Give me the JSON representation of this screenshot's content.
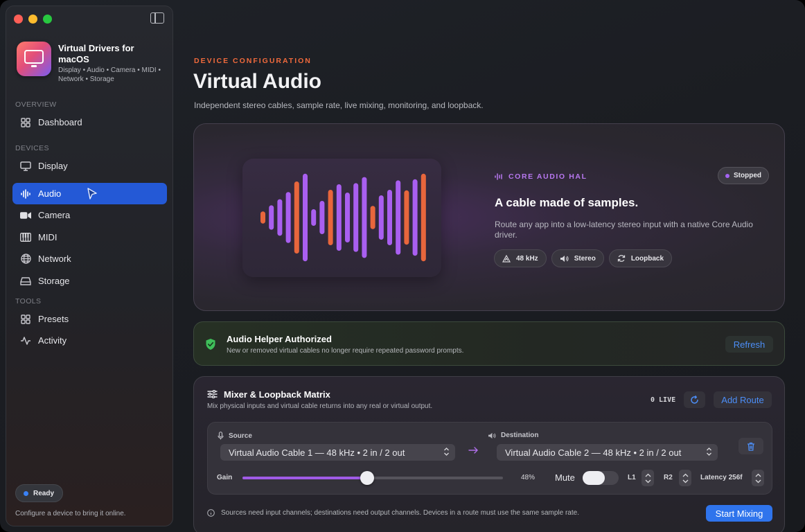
{
  "sidebar": {
    "app_title": "Virtual Drivers for macOS",
    "app_subtitle": "Display • Audio • Camera • MIDI • Network • Storage",
    "sections": {
      "overview": "OVERVIEW",
      "devices": "DEVICES",
      "tools": "TOOLS"
    },
    "items": [
      {
        "label": "Dashboard",
        "icon": "grid-icon"
      },
      {
        "label": "Display",
        "icon": "display-icon"
      },
      {
        "label": "Audio",
        "icon": "waveform-icon",
        "active": true
      },
      {
        "label": "Camera",
        "icon": "video-camera-icon"
      },
      {
        "label": "MIDI",
        "icon": "piano-keys-icon"
      },
      {
        "label": "Network",
        "icon": "globe-icon"
      },
      {
        "label": "Storage",
        "icon": "drive-icon"
      },
      {
        "label": "Presets",
        "icon": "grid-icon"
      },
      {
        "label": "Activity",
        "icon": "activity-icon"
      }
    ],
    "status": "Ready",
    "hint": "Configure a device to bring it online."
  },
  "header": {
    "eyebrow": "DEVICE CONFIGURATION",
    "title": "Virtual Audio",
    "subtitle": "Independent stereo cables, sample rate, live mixing, monitoring, and loopback."
  },
  "hero": {
    "tag": "CORE AUDIO HAL",
    "status": "Stopped",
    "headline": "A cable made of samples.",
    "description": "Route any app into a low-latency stereo input with a native Core Audio driver.",
    "chips": [
      {
        "label": "48 kHz",
        "icon": "waveform-triangle-icon"
      },
      {
        "label": "Stereo",
        "icon": "speaker-icon"
      },
      {
        "label": "Loopback",
        "icon": "loop-arrows-icon"
      }
    ]
  },
  "auth": {
    "title": "Audio Helper Authorized",
    "subtitle": "New or removed virtual cables no longer require repeated password prompts.",
    "refresh_label": "Refresh"
  },
  "mixer": {
    "title": "Mixer & Loopback Matrix",
    "subtitle": "Mix physical inputs and virtual cable returns into any real or virtual output.",
    "live_count": "0 LIVE",
    "add_route_label": "Add Route",
    "route": {
      "source_label": "Source",
      "source_value": "Virtual Audio Cable 1 — 48 kHz • 2 in / 2 out",
      "destination_label": "Destination",
      "destination_value": "Virtual Audio Cable 2 — 48 kHz • 2 in / 2 out",
      "gain_label": "Gain",
      "gain_value": 0.48,
      "gain_text": "48%",
      "mute_label": "Mute",
      "mute_on": false,
      "left_channel": "L1",
      "right_channel": "R2",
      "latency": "Latency 256f"
    },
    "footnote": "Sources need input channels; destinations need output channels. Devices in a route must use the same sample rate.",
    "start_label": "Start Mixing"
  },
  "colors": {
    "accent_blue": "#2459d6",
    "accent_orange": "#f06a3c",
    "accent_purple": "#a463f2"
  }
}
